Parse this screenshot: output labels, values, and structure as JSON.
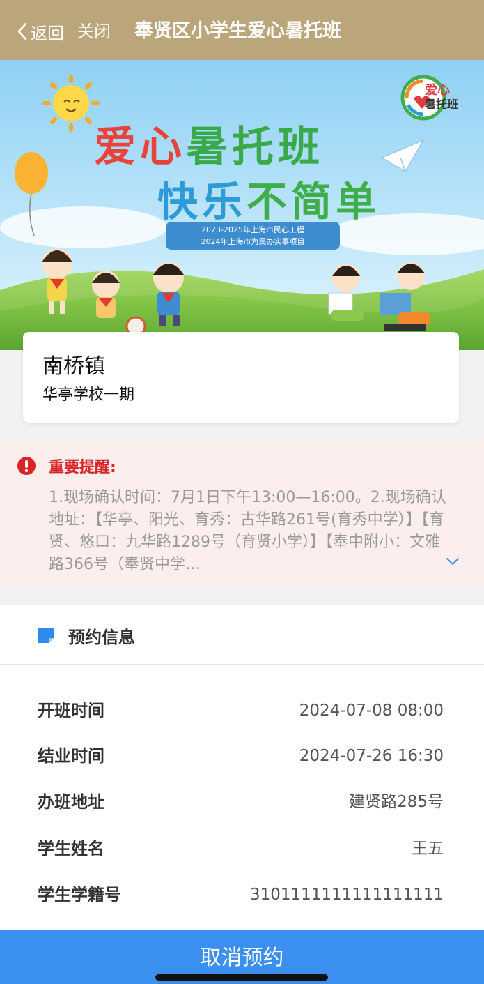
{
  "nav": {
    "back_label": "返回",
    "close_label": "关闭",
    "title": "奉贤区小学生爱心暑托班"
  },
  "banner": {
    "headline_part1": "爱心",
    "headline_part2": "暑托班",
    "subline_part1": "快乐",
    "subline_part2": "不简单",
    "ribbon_line1": "2023-2025年上海市民心工程",
    "ribbon_line2": "2024年上海市为民办实事项目",
    "logo_line1": "爱心",
    "logo_line2": "暑托班"
  },
  "location": {
    "town": "南桥镇",
    "school": "华亭学校一期"
  },
  "reminder": {
    "title": "重要提醒:",
    "body": "1.现场确认时间：7月1日下午13:00—16:00。2.现场确认地址：【华亭、阳光、育秀：古华路261号(育秀中学）】【育贤、悠口：九华路1289号（育贤小学）】【奉中附小：文雅路366号（奉贤中学…"
  },
  "booking": {
    "section_title": "预约信息",
    "rows": [
      {
        "label": "开班时间",
        "value": "2024-07-08 08:00"
      },
      {
        "label": "结业时间",
        "value": "2024-07-26 16:30"
      },
      {
        "label": "办班地址",
        "value": "建贤路285号"
      },
      {
        "label": "学生姓名",
        "value": "王五"
      },
      {
        "label": "学生学籍号",
        "value": "3101111111111111111"
      }
    ]
  },
  "actions": {
    "cancel_label": "取消预约"
  },
  "colors": {
    "header_bg": "#bba57a",
    "alert_red": "#d92525",
    "reminder_bg": "#fdeeee",
    "primary_blue": "#3b8fef"
  }
}
